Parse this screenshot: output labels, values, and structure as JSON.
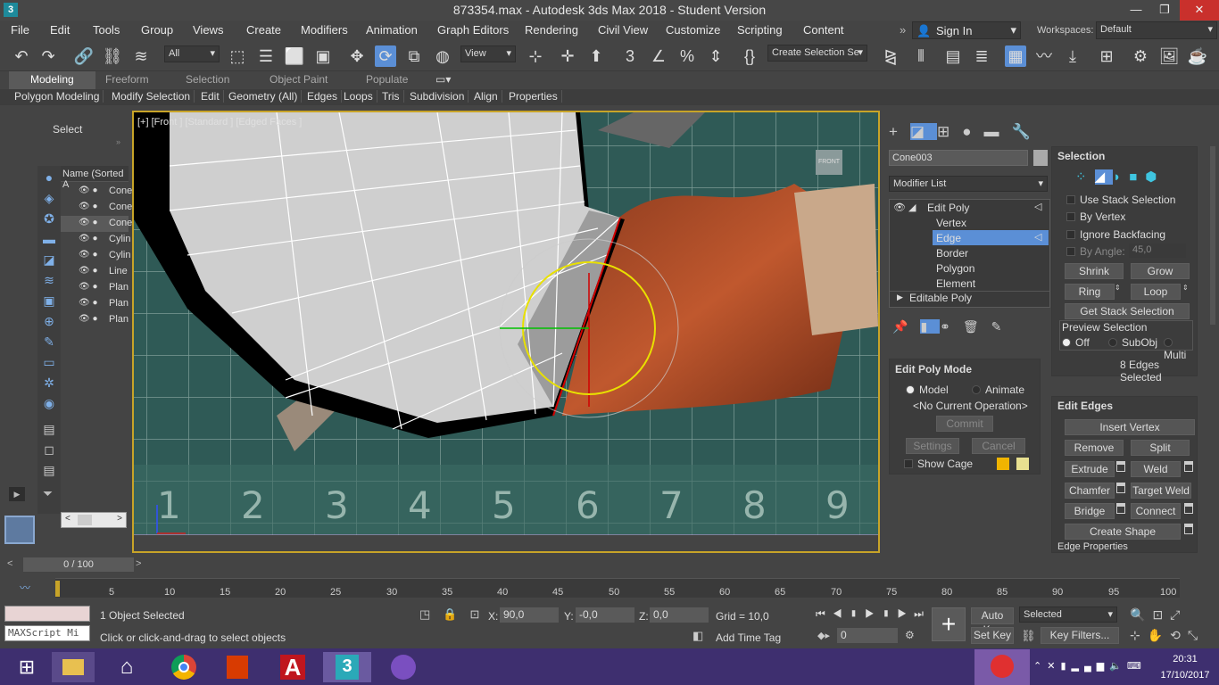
{
  "window": {
    "title": "873354.max - Autodesk 3ds Max 2018 - Student Version",
    "app_icon": "3",
    "controls": [
      "—",
      "❐",
      "✕"
    ]
  },
  "menu": [
    "File",
    "Edit",
    "Tools",
    "Group",
    "Views",
    "Create",
    "Modifiers",
    "Animation",
    "Graph Editors",
    "Rendering",
    "Civil View",
    "Customize",
    "Scripting",
    "Content"
  ],
  "account": {
    "sign_in": "Sign In",
    "workspaces_label": "Workspaces:",
    "workspace": "Default"
  },
  "toolbar": {
    "filter": "All",
    "ref_coord": "View",
    "selection_set": "Create Selection Se"
  },
  "ribbon": {
    "tabs": [
      "Modeling",
      "Freeform",
      "Selection",
      "Object Paint",
      "Populate"
    ],
    "items": [
      "Polygon Modeling",
      "Modify Selection",
      "Edit",
      "Geometry (All)",
      "Edges",
      "Loops",
      "Tris",
      "Subdivision",
      "Align",
      "Properties"
    ]
  },
  "scene_explorer": {
    "select_label": "Select",
    "column": "Name (Sorted A",
    "rows": [
      "Cone",
      "Cone",
      "Cone",
      "Cylin",
      "Cylin",
      "Line",
      "Plan",
      "Plan",
      "Plan"
    ]
  },
  "viewport": {
    "label": "[+] [Front ] [Standard ] [Edged Faces ]",
    "viewcube": "FRONT",
    "ruler_numbers": [
      "1",
      "2",
      "3",
      "4",
      "5",
      "6",
      "7",
      "8",
      "9"
    ]
  },
  "command_panel": {
    "object_name": "Cone003",
    "modifier_list": "Modifier List",
    "stack": [
      "Edit Poly",
      "Vertex",
      "Edge",
      "Border",
      "Polygon",
      "Element",
      "Editable Poly"
    ],
    "edit_poly_mode": {
      "title": "Edit Poly Mode",
      "model": "Model",
      "animate": "Animate",
      "operation": "<No Current Operation>",
      "commit": "Commit",
      "settings": "Settings",
      "cancel": "Cancel",
      "show_cage": "Show Cage"
    },
    "selection": {
      "title": "Selection",
      "use_stack": "Use Stack Selection",
      "by_vertex": "By Vertex",
      "ignore_backfacing": "Ignore Backfacing",
      "by_angle": "By Angle:",
      "angle_value": "45,0",
      "shrink": "Shrink",
      "grow": "Grow",
      "ring": "Ring",
      "loop": "Loop",
      "get_stack": "Get Stack Selection",
      "preview": "Preview Selection",
      "preview_opts": [
        "Off",
        "SubObj",
        "Multi"
      ],
      "count": "8 Edges Selected"
    },
    "edit_edges": {
      "title": "Edit Edges",
      "insert_vertex": "Insert Vertex",
      "remove": "Remove",
      "split": "Split",
      "extrude": "Extrude",
      "weld": "Weld",
      "chamfer": "Chamfer",
      "target_weld": "Target Weld",
      "bridge": "Bridge",
      "connect": "Connect",
      "create_shape": "Create Shape",
      "edge_properties": "Edge Properties"
    }
  },
  "timeline": {
    "frame": "0 / 100",
    "ticks": [
      "5",
      "10",
      "15",
      "20",
      "25",
      "30",
      "35",
      "40",
      "45",
      "50",
      "55",
      "60",
      "65",
      "70",
      "75",
      "80",
      "85",
      "90",
      "95",
      "100"
    ]
  },
  "status": {
    "selected": "1 Object Selected",
    "prompt": "Click or click-and-drag to select objects",
    "maxscript": "MAXScript Mi",
    "x_label": "X:",
    "x": "90,0",
    "y_label": "Y:",
    "y": "-0,0",
    "z_label": "Z:",
    "z": "0,0",
    "grid": "Grid = 10,0",
    "add_time_tag": "Add Time Tag",
    "auto_key": "Auto Key",
    "set_key": "Set Key",
    "key_mode": "Selected",
    "key_filters": "Key Filters...",
    "frame_field": "0"
  },
  "taskbar": {
    "time": "20:31",
    "date": "17/10/2017"
  },
  "colors": {
    "accent": "#5b8fd6",
    "viewport_border": "#c8a428",
    "cage1": "#f0b400",
    "cage2": "#e8e090"
  }
}
